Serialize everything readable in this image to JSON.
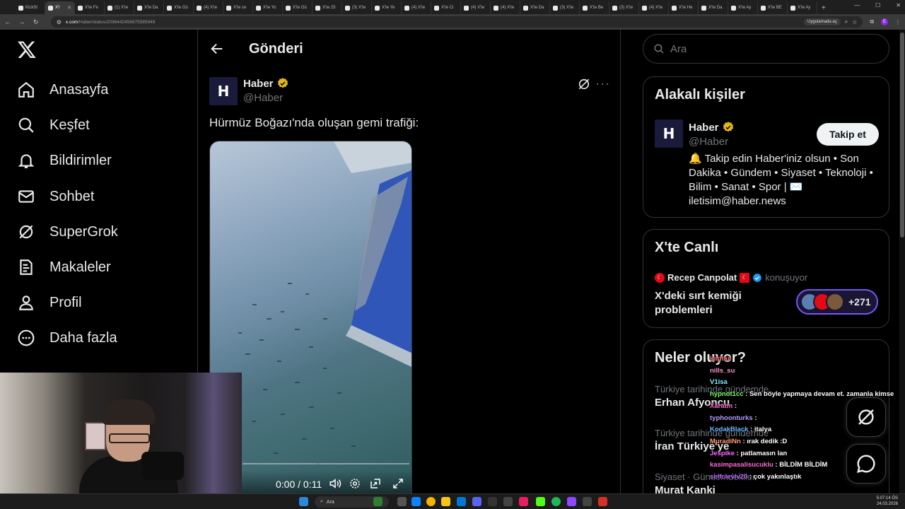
{
  "browser": {
    "tabs": [
      "KickSt",
      "X'l",
      "X'te Fe",
      "(1) X'te",
      "X'te Da",
      "X'te Gü",
      "(4) X'te",
      "X'te ce",
      "X'te Yo",
      "X'te Gü",
      "X'te 23",
      "(3) X'te",
      "X'te Ye",
      "(4) X'te",
      "X'te Ci",
      "(4) X'te",
      "(4) X'te",
      "X'te Da",
      "(3) X'te",
      "X'te Be",
      "(3) X'te",
      "(4) X'te",
      "X'te He",
      "X'te Da",
      "X'te Ay",
      "X'te BE",
      "X'te Ay"
    ],
    "active_tab_index": 1,
    "url_host": "x.com",
    "url_path": "/Haber/status/2036442456875585949",
    "app_chip": "Uygulamada aç",
    "profile_initial": "E"
  },
  "nav": {
    "items": [
      {
        "label": "Anasayfa",
        "icon": "home-icon"
      },
      {
        "label": "Keşfet",
        "icon": "search-icon"
      },
      {
        "label": "Bildirimler",
        "icon": "bell-icon"
      },
      {
        "label": "Sohbet",
        "icon": "mail-icon"
      },
      {
        "label": "SuperGrok",
        "icon": "grok-icon"
      },
      {
        "label": "Makaleler",
        "icon": "article-icon"
      },
      {
        "label": "Profil",
        "icon": "person-icon"
      },
      {
        "label": "Daha fazla",
        "icon": "more-circle-icon"
      }
    ]
  },
  "post": {
    "header_title": "Gönderi",
    "author_name": "Haber",
    "author_handle": "@Haber",
    "avatar_letter": "H",
    "text": "Hürmüz Boğazı'nda oluşan gemi trafiği:",
    "video_time": "0:00 / 0:11",
    "video_progress": 0
  },
  "sidebar": {
    "search_placeholder": "Ara",
    "related": {
      "title": "Alakalı kişiler",
      "name": "Haber",
      "handle": "@Haber",
      "follow_label": "Takip et",
      "bio": "🔔 Takip edin Haber'iniz olsun • Son Dakika • Gündem • Siyaset • Teknoloji • Bilim • Sanat • Spor | ✉️ iletisim@haber.news"
    },
    "live": {
      "title": "X'te Canlı",
      "host": "Recep Canpolat",
      "status": "konuşuyor",
      "topic": "X'deki sırt kemiği problemleri",
      "count": "+271"
    },
    "trends": {
      "title": "Neler oluyor?",
      "items": [
        {
          "context": "Türkiye tarihinde gündemde",
          "title": "Erhan Afyoncu"
        },
        {
          "context": "Türkiye tarihinde gündemde",
          "title": "İran Türkiye'ye"
        },
        {
          "context": "Siyaset · Gündemdekiler",
          "title": "Murat Kanki"
        }
      ]
    }
  },
  "chat": [
    {
      "user": "kaptan",
      "msg": "",
      "color": "#ff6b6b"
    },
    {
      "user": "nills_su",
      "msg": "",
      "color": "#ff8fd0"
    },
    {
      "user": "V1isa",
      "msg": "",
      "color": "#7ef0ff"
    },
    {
      "user": "hypnot1cc",
      "msg": ": Sen böyle yapmaya devam et. zamanla kimse yazmacak :D",
      "color": "#7cff6b"
    },
    {
      "user": "Xaratm",
      "msg": ":",
      "color": "#ff6bd0"
    },
    {
      "user": "typhoonturks",
      "msg": ":",
      "color": "#b69cff"
    },
    {
      "user": "KodakBlack",
      "msg": ": italya",
      "color": "#6bb7ff"
    },
    {
      "user": "MuradiNn",
      "msg": ": ırak dedik :D",
      "color": "#ff9f6b"
    },
    {
      "user": "Jespike",
      "msg": ": patlamasın lan",
      "color": "#ff6bff"
    },
    {
      "user": "kasimpasalisucuklu",
      "msg": ": BİLDİM BİLDİM",
      "color": "#ff6bd0"
    },
    {
      "user": "selfclevlv20",
      "msg": ": çok yakınlaştık",
      "color": "#c06bff"
    }
  ],
  "taskbar": {
    "search_label": "Ara",
    "time": "5:07:14 ÖS",
    "date": "24.03.2026"
  },
  "colors": {
    "accent": "#1d9bf0",
    "verified_gold": "#e2b719",
    "live_purple": "#7856ff"
  }
}
